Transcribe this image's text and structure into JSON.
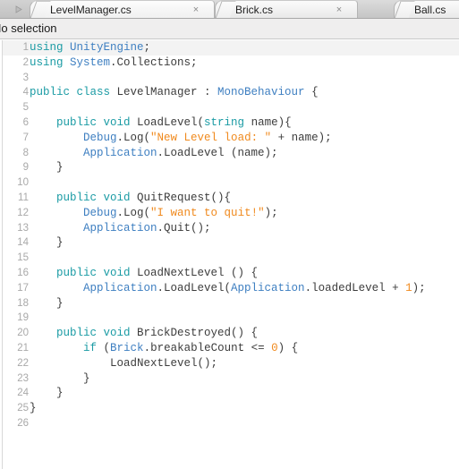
{
  "window": {
    "title": "LevelManager.cs",
    "file_extension": ".cs"
  },
  "tabbar": {
    "scroll_right_icon": "triangle-right-icon",
    "close_icon_glyph": "×",
    "tabs": [
      {
        "label": "LevelManager.cs",
        "active": true,
        "closable": true
      },
      {
        "label": "Brick.cs",
        "active": false,
        "closable": true
      },
      {
        "label": "Ball.cs",
        "active": false,
        "closable": true
      }
    ]
  },
  "selection_bar": {
    "text": "No selection"
  },
  "editor": {
    "language": "csharp",
    "current_line": 1,
    "total_lines": 26,
    "colors": {
      "keyword": "#1a9ba4",
      "type": "#3e7fc1",
      "string": "#f08a1e",
      "number": "#f08a1e",
      "plain": "#3c3c3c",
      "line_number": "#a9a9a9",
      "background": "#ffffff",
      "current_line_bg": "#f3f3f3"
    },
    "lines": [
      {
        "n": 1,
        "tokens": [
          {
            "t": "kw",
            "v": "using"
          },
          {
            "t": "pl",
            "v": " "
          },
          {
            "t": "type",
            "v": "UnityEngine"
          },
          {
            "t": "pl",
            "v": ";"
          }
        ]
      },
      {
        "n": 2,
        "tokens": [
          {
            "t": "kw",
            "v": "using"
          },
          {
            "t": "pl",
            "v": " "
          },
          {
            "t": "type",
            "v": "System"
          },
          {
            "t": "pl",
            "v": ".Collections;"
          }
        ]
      },
      {
        "n": 3,
        "tokens": []
      },
      {
        "n": 4,
        "tokens": [
          {
            "t": "kw",
            "v": "public class"
          },
          {
            "t": "pl",
            "v": " LevelManager : "
          },
          {
            "t": "type",
            "v": "MonoBehaviour"
          },
          {
            "t": "pl",
            "v": " {"
          }
        ]
      },
      {
        "n": 5,
        "tokens": []
      },
      {
        "n": 6,
        "tokens": [
          {
            "t": "pl",
            "v": "    "
          },
          {
            "t": "kw",
            "v": "public void"
          },
          {
            "t": "pl",
            "v": " LoadLevel("
          },
          {
            "t": "kw",
            "v": "string"
          },
          {
            "t": "pl",
            "v": " name){"
          }
        ]
      },
      {
        "n": 7,
        "tokens": [
          {
            "t": "pl",
            "v": "        "
          },
          {
            "t": "type",
            "v": "Debug"
          },
          {
            "t": "pl",
            "v": ".Log("
          },
          {
            "t": "str",
            "v": "\"New Level load: \""
          },
          {
            "t": "pl",
            "v": " + name);"
          }
        ]
      },
      {
        "n": 8,
        "tokens": [
          {
            "t": "pl",
            "v": "        "
          },
          {
            "t": "type",
            "v": "Application"
          },
          {
            "t": "pl",
            "v": ".LoadLevel (name);"
          }
        ]
      },
      {
        "n": 9,
        "tokens": [
          {
            "t": "pl",
            "v": "    }"
          }
        ]
      },
      {
        "n": 10,
        "tokens": []
      },
      {
        "n": 11,
        "tokens": [
          {
            "t": "pl",
            "v": "    "
          },
          {
            "t": "kw",
            "v": "public void"
          },
          {
            "t": "pl",
            "v": " QuitRequest(){"
          }
        ]
      },
      {
        "n": 12,
        "tokens": [
          {
            "t": "pl",
            "v": "        "
          },
          {
            "t": "type",
            "v": "Debug"
          },
          {
            "t": "pl",
            "v": ".Log("
          },
          {
            "t": "str",
            "v": "\"I want to quit!\""
          },
          {
            "t": "pl",
            "v": ");"
          }
        ]
      },
      {
        "n": 13,
        "tokens": [
          {
            "t": "pl",
            "v": "        "
          },
          {
            "t": "type",
            "v": "Application"
          },
          {
            "t": "pl",
            "v": ".Quit();"
          }
        ]
      },
      {
        "n": 14,
        "tokens": [
          {
            "t": "pl",
            "v": "    }"
          }
        ]
      },
      {
        "n": 15,
        "tokens": []
      },
      {
        "n": 16,
        "tokens": [
          {
            "t": "pl",
            "v": "    "
          },
          {
            "t": "kw",
            "v": "public void"
          },
          {
            "t": "pl",
            "v": " LoadNextLevel () {"
          }
        ]
      },
      {
        "n": 17,
        "tokens": [
          {
            "t": "pl",
            "v": "        "
          },
          {
            "t": "type",
            "v": "Application"
          },
          {
            "t": "pl",
            "v": ".LoadLevel("
          },
          {
            "t": "type",
            "v": "Application"
          },
          {
            "t": "pl",
            "v": ".loadedLevel + "
          },
          {
            "t": "num",
            "v": "1"
          },
          {
            "t": "pl",
            "v": ");"
          }
        ]
      },
      {
        "n": 18,
        "tokens": [
          {
            "t": "pl",
            "v": "    }"
          }
        ]
      },
      {
        "n": 19,
        "tokens": []
      },
      {
        "n": 20,
        "tokens": [
          {
            "t": "pl",
            "v": "    "
          },
          {
            "t": "kw",
            "v": "public void"
          },
          {
            "t": "pl",
            "v": " BrickDestroyed() {"
          }
        ]
      },
      {
        "n": 21,
        "tokens": [
          {
            "t": "pl",
            "v": "        "
          },
          {
            "t": "kw",
            "v": "if"
          },
          {
            "t": "pl",
            "v": " ("
          },
          {
            "t": "type",
            "v": "Brick"
          },
          {
            "t": "pl",
            "v": ".breakableCount <= "
          },
          {
            "t": "num",
            "v": "0"
          },
          {
            "t": "pl",
            "v": ") {"
          }
        ]
      },
      {
        "n": 22,
        "tokens": [
          {
            "t": "pl",
            "v": "            LoadNextLevel();"
          }
        ]
      },
      {
        "n": 23,
        "tokens": [
          {
            "t": "pl",
            "v": "        }"
          }
        ]
      },
      {
        "n": 24,
        "tokens": [
          {
            "t": "pl",
            "v": "    }"
          }
        ]
      },
      {
        "n": 25,
        "tokens": [
          {
            "t": "pl",
            "v": "}"
          }
        ]
      },
      {
        "n": 26,
        "tokens": []
      }
    ]
  }
}
